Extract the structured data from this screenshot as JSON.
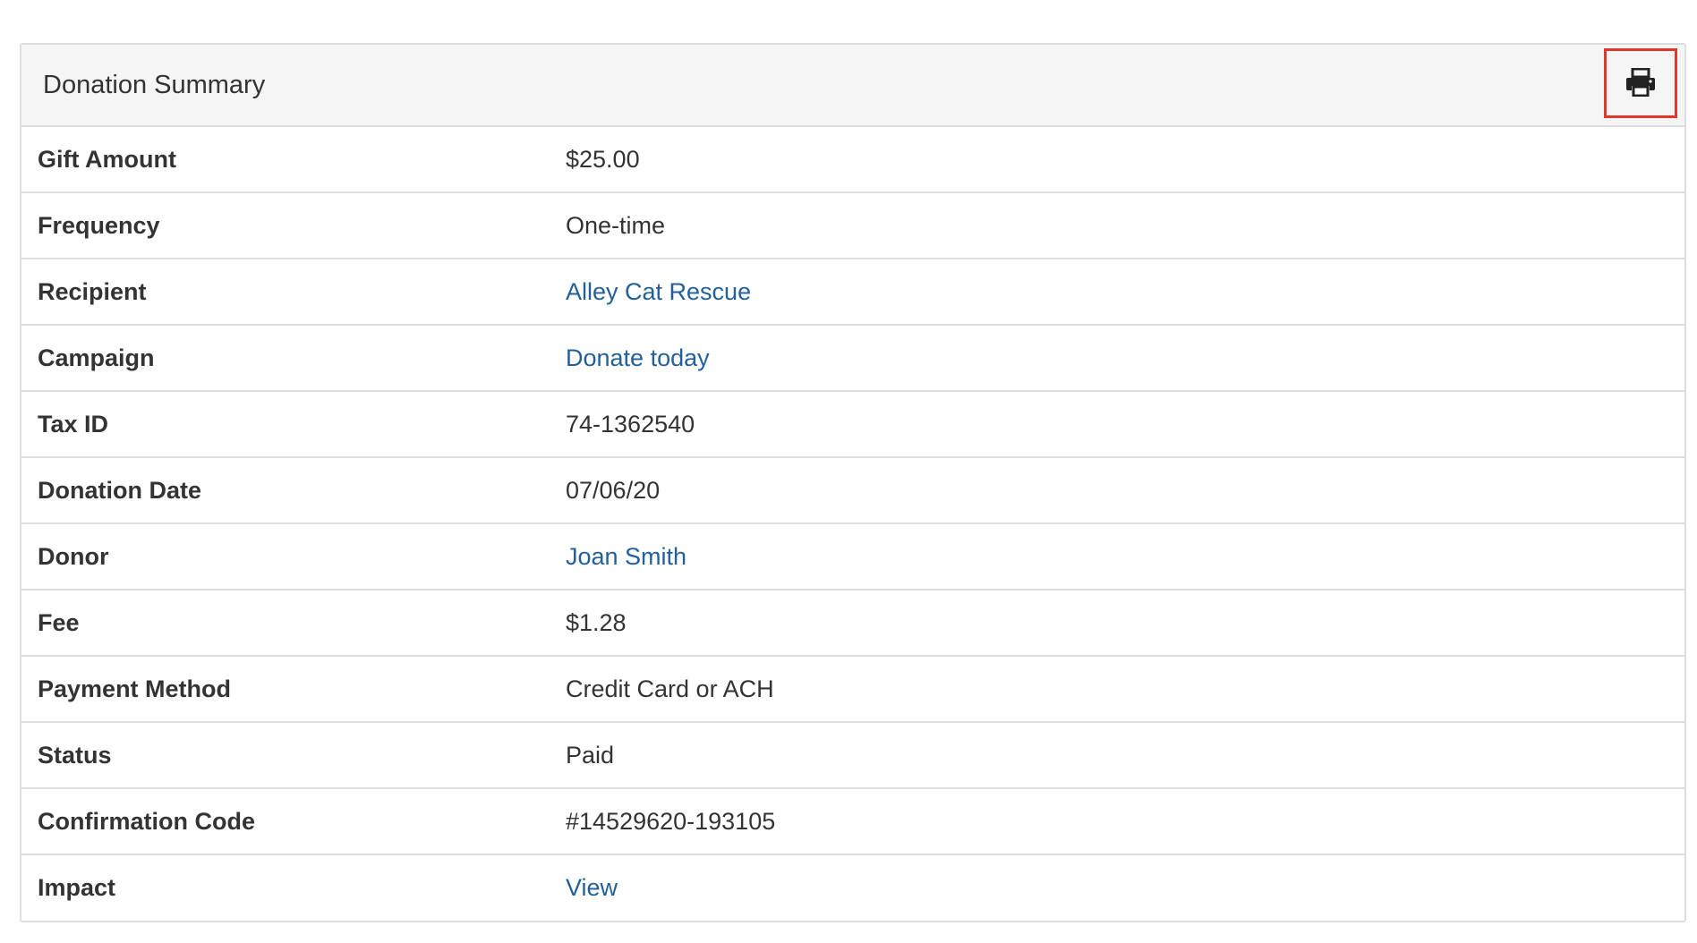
{
  "panel": {
    "title": "Donation Summary",
    "print_icon": "print-icon"
  },
  "rows": [
    {
      "label": "Gift Amount",
      "value": "$25.00",
      "link": false
    },
    {
      "label": "Frequency",
      "value": "One-time",
      "link": false
    },
    {
      "label": "Recipient",
      "value": "Alley Cat Rescue",
      "link": true
    },
    {
      "label": "Campaign",
      "value": "Donate today",
      "link": true
    },
    {
      "label": "Tax ID",
      "value": "74-1362540",
      "link": false
    },
    {
      "label": "Donation Date",
      "value": "07/06/20",
      "link": false
    },
    {
      "label": "Donor",
      "value": "Joan Smith",
      "link": true
    },
    {
      "label": "Fee",
      "value": "$1.28",
      "link": false
    },
    {
      "label": "Payment Method",
      "value": "Credit Card or ACH",
      "link": false
    },
    {
      "label": "Status",
      "value": "Paid",
      "link": false
    },
    {
      "label": "Confirmation Code",
      "value": "#14529620-193105",
      "link": false
    },
    {
      "label": "Impact",
      "value": "View",
      "link": true
    }
  ],
  "colors": {
    "link": "#23609b",
    "highlight_border": "#e0392b",
    "header_bg": "#f5f5f5",
    "border": "#dddddd"
  }
}
